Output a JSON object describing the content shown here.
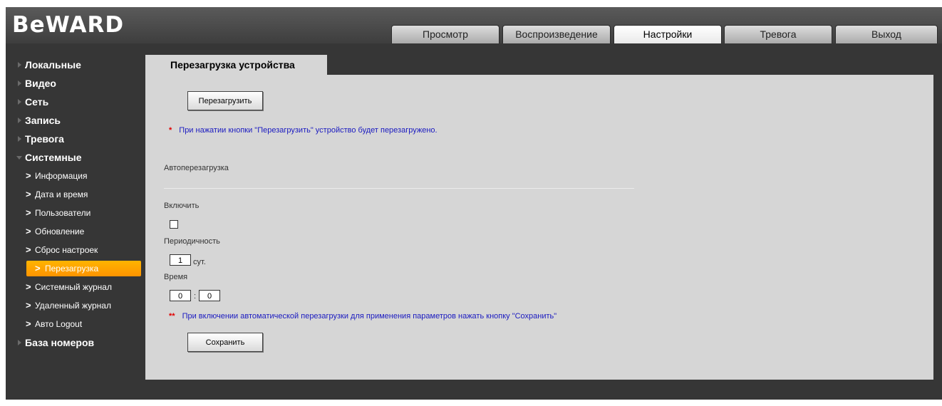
{
  "brand": {
    "logo_text": "BeWARD"
  },
  "tabs": [
    {
      "label": "Просмотр"
    },
    {
      "label": "Воспроизведение"
    },
    {
      "label": "Настройки"
    },
    {
      "label": "Тревога"
    },
    {
      "label": "Выход"
    }
  ],
  "active_tab": "Настройки",
  "sidebar": {
    "top": [
      {
        "label": "Локальные"
      },
      {
        "label": "Видео"
      },
      {
        "label": "Сеть"
      },
      {
        "label": "Запись"
      },
      {
        "label": "Тревога"
      },
      {
        "label": "Системные"
      }
    ],
    "sub": [
      {
        "label": "Информация"
      },
      {
        "label": "Дата и время"
      },
      {
        "label": "Пользователи"
      },
      {
        "label": "Обновление"
      },
      {
        "label": "Сброс настроек"
      },
      {
        "label": "Перезагрузка"
      },
      {
        "label": "Системный журнал"
      },
      {
        "label": "Удаленный журнал"
      },
      {
        "label": "Авто Logout"
      }
    ],
    "bottom": {
      "label": "База номеров"
    }
  },
  "page": {
    "title": "Перезагрузка устройства",
    "reboot_button": "Перезагрузить",
    "note1_mark": "*",
    "note1": "При нажатии кнопки \"Перезагрузить\" устройство будет перезагружено.",
    "section_title": "Автоперезагрузка",
    "enable_label": "Включить",
    "enable_checked": false,
    "period_label": "Периодичность",
    "period_value": "1",
    "period_unit": "сут.",
    "time_label": "Время",
    "time_hour": "0",
    "time_sep": ":",
    "time_minute": "0",
    "note2_mark": "**",
    "note2": "При включении автоматической перезагрузки для применения параметров нажать кнопку \"Сохранить\"",
    "save_button": "Сохранить"
  },
  "colors": {
    "background": "#363636",
    "content": "#d6d6d6",
    "accent": "#ffa000",
    "note": "#1a1ac0",
    "required": "#e00000"
  }
}
